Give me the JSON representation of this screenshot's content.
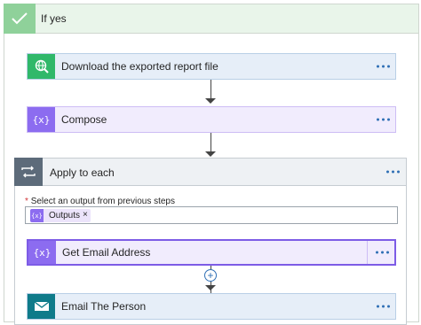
{
  "condition": {
    "title": "If yes"
  },
  "actions": [
    {
      "name": "download",
      "title": "Download the exported report file",
      "icon": "globe-search-icon",
      "color": "#30b86a"
    },
    {
      "name": "compose",
      "title": "Compose",
      "icon": "compose-braces-icon",
      "color": "#8c6cf0"
    },
    {
      "name": "get-email",
      "title": "Get Email Address",
      "icon": "compose-braces-icon",
      "color": "#8c6cf0"
    },
    {
      "name": "email-person",
      "title": "Email The Person",
      "icon": "envelope-icon",
      "color": "#0f7b8a"
    }
  ],
  "loop": {
    "title": "Apply to each",
    "select_label": "Select an output from previous steps",
    "required_marker": "*",
    "token": {
      "label": "Outputs",
      "close": "×"
    }
  },
  "colors": {
    "condition_bg": "#e9f5ea",
    "action_bg_blue": "#e6eef8",
    "action_bg_purple": "#f1ecfd",
    "loop_header_bg": "#eef1f4",
    "accent": "#2f6fb5"
  }
}
